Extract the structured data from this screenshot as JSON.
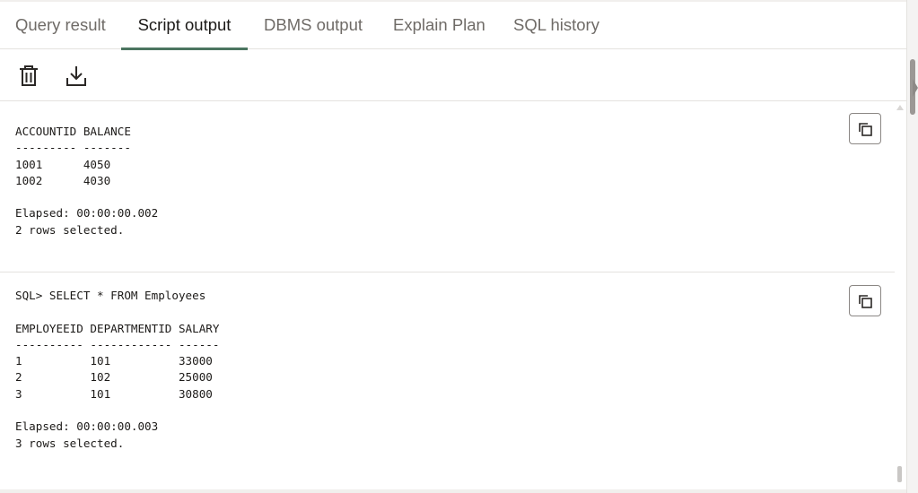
{
  "tabs": [
    {
      "label": "Query result",
      "active": false
    },
    {
      "label": "Script output",
      "active": true
    },
    {
      "label": "DBMS output",
      "active": false
    },
    {
      "label": "Explain Plan",
      "active": false
    },
    {
      "label": "SQL history",
      "active": false
    }
  ],
  "toolbar": {
    "clear_icon": "trash-icon",
    "download_icon": "download-icon"
  },
  "output": {
    "blocks": [
      {
        "text": "ACCOUNTID BALANCE\n--------- -------\n1001      4050\n1002      4030\n\nElapsed: 00:00:00.002\n2 rows selected.",
        "copy_icon": "copy-icon"
      },
      {
        "text": "SQL> SELECT * FROM Employees\n\nEMPLOYEEID DEPARTMENTID SALARY\n---------- ------------ ------\n1          101          33000\n2          102          25000\n3          101          30800\n\nElapsed: 00:00:00.003\n3 rows selected.",
        "copy_icon": "copy-icon"
      }
    ]
  },
  "colors": {
    "active_tab_underline": "#4b7560",
    "text": "#1c1a18",
    "inactive_tab": "#6f6b67"
  }
}
